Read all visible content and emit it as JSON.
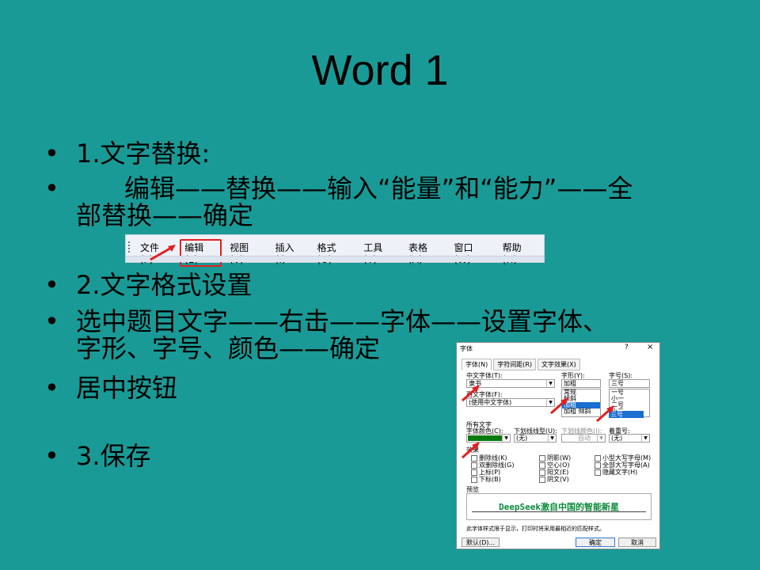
{
  "slide": {
    "title": "Word 1",
    "bullet_symbol": "•",
    "bullets": [
      "1.文字替换:",
      "      编辑——替换——输入“能量”和“能力”——全",
      "部替换——确定",
      "2.文字格式设置",
      "选中题目文字——右击——字体——设置字体、",
      "字形、字号、颜色——确定",
      "居中按钮",
      "3.保存"
    ]
  },
  "menubar": {
    "items": [
      "文件(F)",
      "编辑(E)",
      "视图(V)",
      "插入(I)",
      "格式(O)",
      "工具(T)",
      "表格(A)",
      "窗口(W)",
      "帮助(H)"
    ],
    "highlighted": "编辑(E)"
  },
  "font_dialog": {
    "title": "字体",
    "help": "?",
    "close": "×",
    "tabs": [
      "字体(N)",
      "字符间距(R)",
      "文字效果(X)"
    ],
    "chinese_font_label": "中文字体(T):",
    "chinese_font_value": "隶书",
    "western_font_label": "西文字体(F):",
    "western_font_value": "(使用中文字体)",
    "style_label": "字形(Y):",
    "style_value": "加粗",
    "style_options": [
      "常规",
      "倾斜",
      "加粗",
      "加粗 倾斜"
    ],
    "size_label": "字号(S):",
    "size_value": "三号",
    "size_options": [
      "一号",
      "小一",
      "二号",
      "小二",
      "三号"
    ],
    "all_text_label": "所有文字",
    "font_color_label": "字体颜色(C):",
    "underline_type_label": "下划线线型(U):",
    "underline_type_value": "(无)",
    "underline_color_label": "下划线颜色(I):",
    "underline_color_value": "自动",
    "emphasis_label": "着重号:",
    "emphasis_value": "(无)",
    "effects_label": "效果",
    "effects": [
      [
        "删除线(K)",
        "阴影(W)",
        "小型大写字母(M)"
      ],
      [
        "双删除线(G)",
        "空心(O)",
        "全部大写字母(A)"
      ],
      [
        "上标(P)",
        "阳文(E)",
        "隐藏文字(H)"
      ],
      [
        "下标(B)",
        "阴文(V)",
        ""
      ]
    ],
    "preview_label": "预览",
    "preview_text": "DeepSeek激自中国的智能新星",
    "note": "此字体样式限于显示，打印时将采用最相近的匹配样式。",
    "default_button": "默认(D)...",
    "ok_button": "确定",
    "cancel_button": "取消"
  },
  "colors": {
    "background": "#1a9a96",
    "font_color_swatch": "#0a7a10",
    "highlight_border": "#e02020",
    "preview_text": "#0a8a3a",
    "selection": "#1a6fd0"
  }
}
